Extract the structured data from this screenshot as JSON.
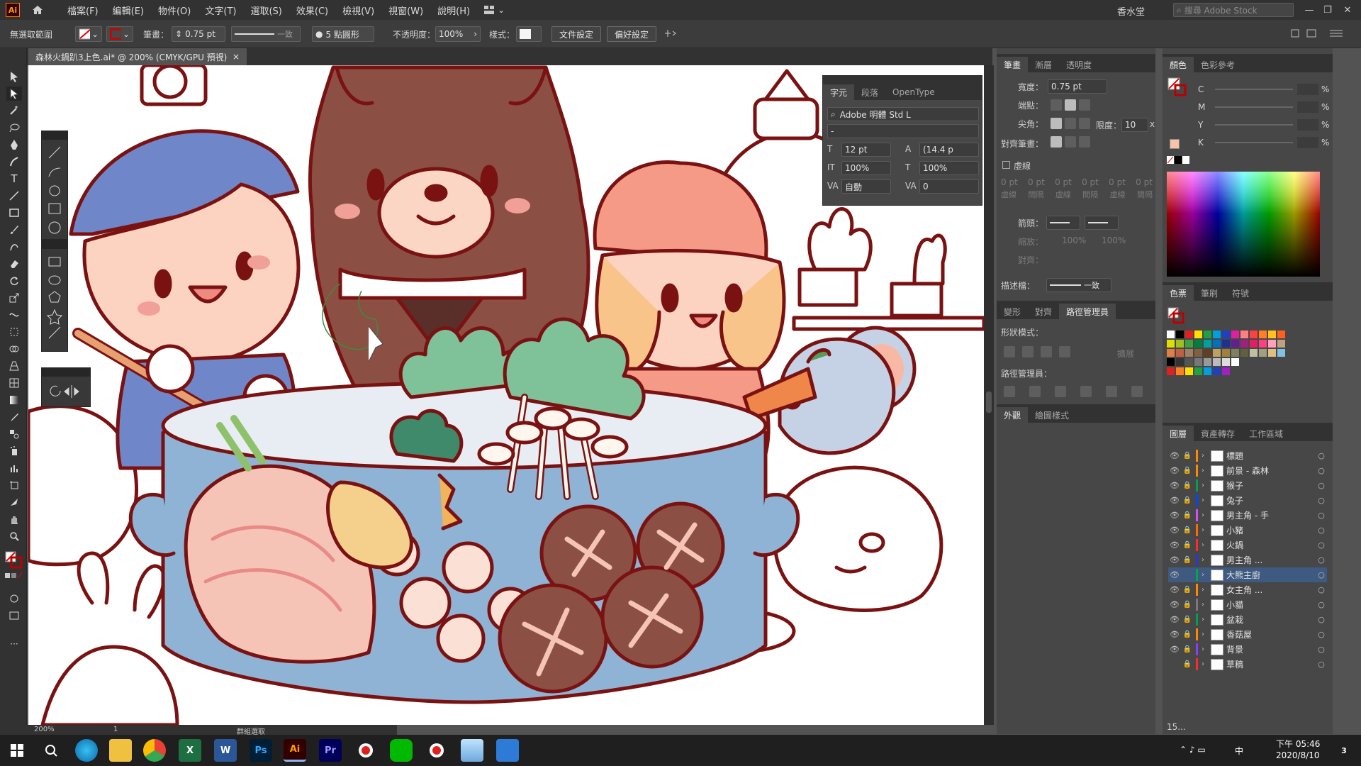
{
  "app": {
    "logo": "Ai",
    "workspace": "香水堂",
    "stock_search_placeholder": "搜尋 Adobe Stock"
  },
  "menu": [
    "檔案(F)",
    "編輯(E)",
    "物件(O)",
    "文字(T)",
    "選取(S)",
    "效果(C)",
    "檢視(V)",
    "視窗(W)",
    "說明(H)"
  ],
  "control": {
    "selection": "無選取範圍",
    "stroke_label": "筆畫：",
    "stroke_value": "0.75 pt",
    "stroke_style": "一致",
    "brush": "5 點圓形",
    "opacity_label": "不透明度：",
    "opacity_value": "100%",
    "style_label": "樣式：",
    "doc_setup": "文件設定",
    "preferences": "偏好設定"
  },
  "document": {
    "tab_title": "森林火鍋趴3上色.ai* @ 200% (CMYK/GPU 預視)",
    "close": "×"
  },
  "character": {
    "tabs": [
      "字元",
      "段落",
      "OpenType"
    ],
    "font_family": "Adobe 明體 Std L",
    "font_style": "-",
    "size": "12 pt",
    "leading": "(14.4 p",
    "vscale": "100%",
    "hscale": "100%",
    "kerning": "自動",
    "tracking": "0"
  },
  "stroke_panel": {
    "tabs": [
      "筆畫",
      "漸層",
      "透明度"
    ],
    "weight_label": "寬度：",
    "weight_value": "0.75 pt",
    "cap_label": "端點：",
    "corner_label": "尖角：",
    "limit_label": "限度：",
    "limit_value": "10",
    "limit_unit": "x",
    "align_label": "對齊筆畫：",
    "dashed_label": "虛線",
    "dash_fields": [
      "0 pt",
      "0 pt",
      "0 pt",
      "0 pt",
      "0 pt",
      "0 pt"
    ],
    "dash_labels": [
      "虛線",
      "間隔",
      "虛線",
      "間隔",
      "虛線",
      "間隔"
    ],
    "arrow_label": "箭頭：",
    "scale_label": "縮放：",
    "scale_values": [
      "100%",
      "100%"
    ],
    "align_arrow_label": "對齊：",
    "profile_label": "描述檔：",
    "profile_value": "一致"
  },
  "pathfinder": {
    "tabs": [
      "變形",
      "對齊",
      "路徑管理員"
    ],
    "shape_modes": "形狀模式：",
    "expand": "擴展",
    "pathfinders": "路徑管理員："
  },
  "appearance": {
    "tabs": [
      "外觀",
      "繪圖樣式"
    ]
  },
  "color_panel": {
    "tabs": [
      "顏色",
      "色彩參考"
    ],
    "channels": [
      {
        "label": "C",
        "unit": "%"
      },
      {
        "label": "M",
        "unit": "%"
      },
      {
        "label": "Y",
        "unit": "%"
      },
      {
        "label": "K",
        "unit": "%"
      }
    ]
  },
  "swatches_panel": {
    "tabs": [
      "色票",
      "筆刷",
      "符號"
    ]
  },
  "layers_panel": {
    "tabs": [
      "圖層",
      "資產轉存",
      "工作區域"
    ],
    "count": "15...",
    "layers": [
      {
        "name": "標題",
        "color": "#ff8a00",
        "visible": true,
        "locked": true,
        "selected": false
      },
      {
        "name": "前景 - 森林",
        "color": "#ff8a00",
        "visible": true,
        "locked": true,
        "selected": false
      },
      {
        "name": "猴子",
        "color": "#00a050",
        "visible": true,
        "locked": true,
        "selected": false
      },
      {
        "name": "兔子",
        "color": "#0046ff",
        "visible": true,
        "locked": true,
        "selected": false
      },
      {
        "name": "男主角 - 手",
        "color": "#d84cff",
        "visible": true,
        "locked": true,
        "selected": false
      },
      {
        "name": "小豬",
        "color": "#ff6a00",
        "visible": true,
        "locked": true,
        "selected": false
      },
      {
        "name": "火鍋",
        "color": "#ff2a2a",
        "visible": true,
        "locked": true,
        "selected": false
      },
      {
        "name": "男主角 ...",
        "color": "#2a36d8",
        "visible": true,
        "locked": true,
        "selected": false
      },
      {
        "name": "大熊主廚",
        "color": "#00a84c",
        "visible": true,
        "locked": false,
        "selected": true
      },
      {
        "name": "女主角 ...",
        "color": "#ff8a00",
        "visible": true,
        "locked": true,
        "selected": false
      },
      {
        "name": "小貓",
        "color": "#7a7a7a",
        "visible": true,
        "locked": true,
        "selected": false
      },
      {
        "name": "盆栽",
        "color": "#00a050",
        "visible": true,
        "locked": true,
        "selected": false
      },
      {
        "name": "香菇屋",
        "color": "#ff8a00",
        "visible": true,
        "locked": true,
        "selected": false
      },
      {
        "name": "背景",
        "color": "#8a3cff",
        "visible": true,
        "locked": true,
        "selected": false
      },
      {
        "name": "草稿",
        "color": "#ff2a2a",
        "visible": false,
        "locked": true,
        "selected": false
      }
    ]
  },
  "status": {
    "zoom": "200%",
    "artboard": "1",
    "tool_hint": "群組選取"
  },
  "taskbar": {
    "time": "下午 05:46",
    "date": "2020/8/10",
    "ime": "中",
    "notifications": "3",
    "apps": [
      "Ai",
      "Pr",
      "Ps",
      "W",
      "X"
    ]
  },
  "colors": {
    "accent_select": "#3e5a80",
    "ai_orange": "#ff9a00",
    "outline": "#7a1212"
  }
}
